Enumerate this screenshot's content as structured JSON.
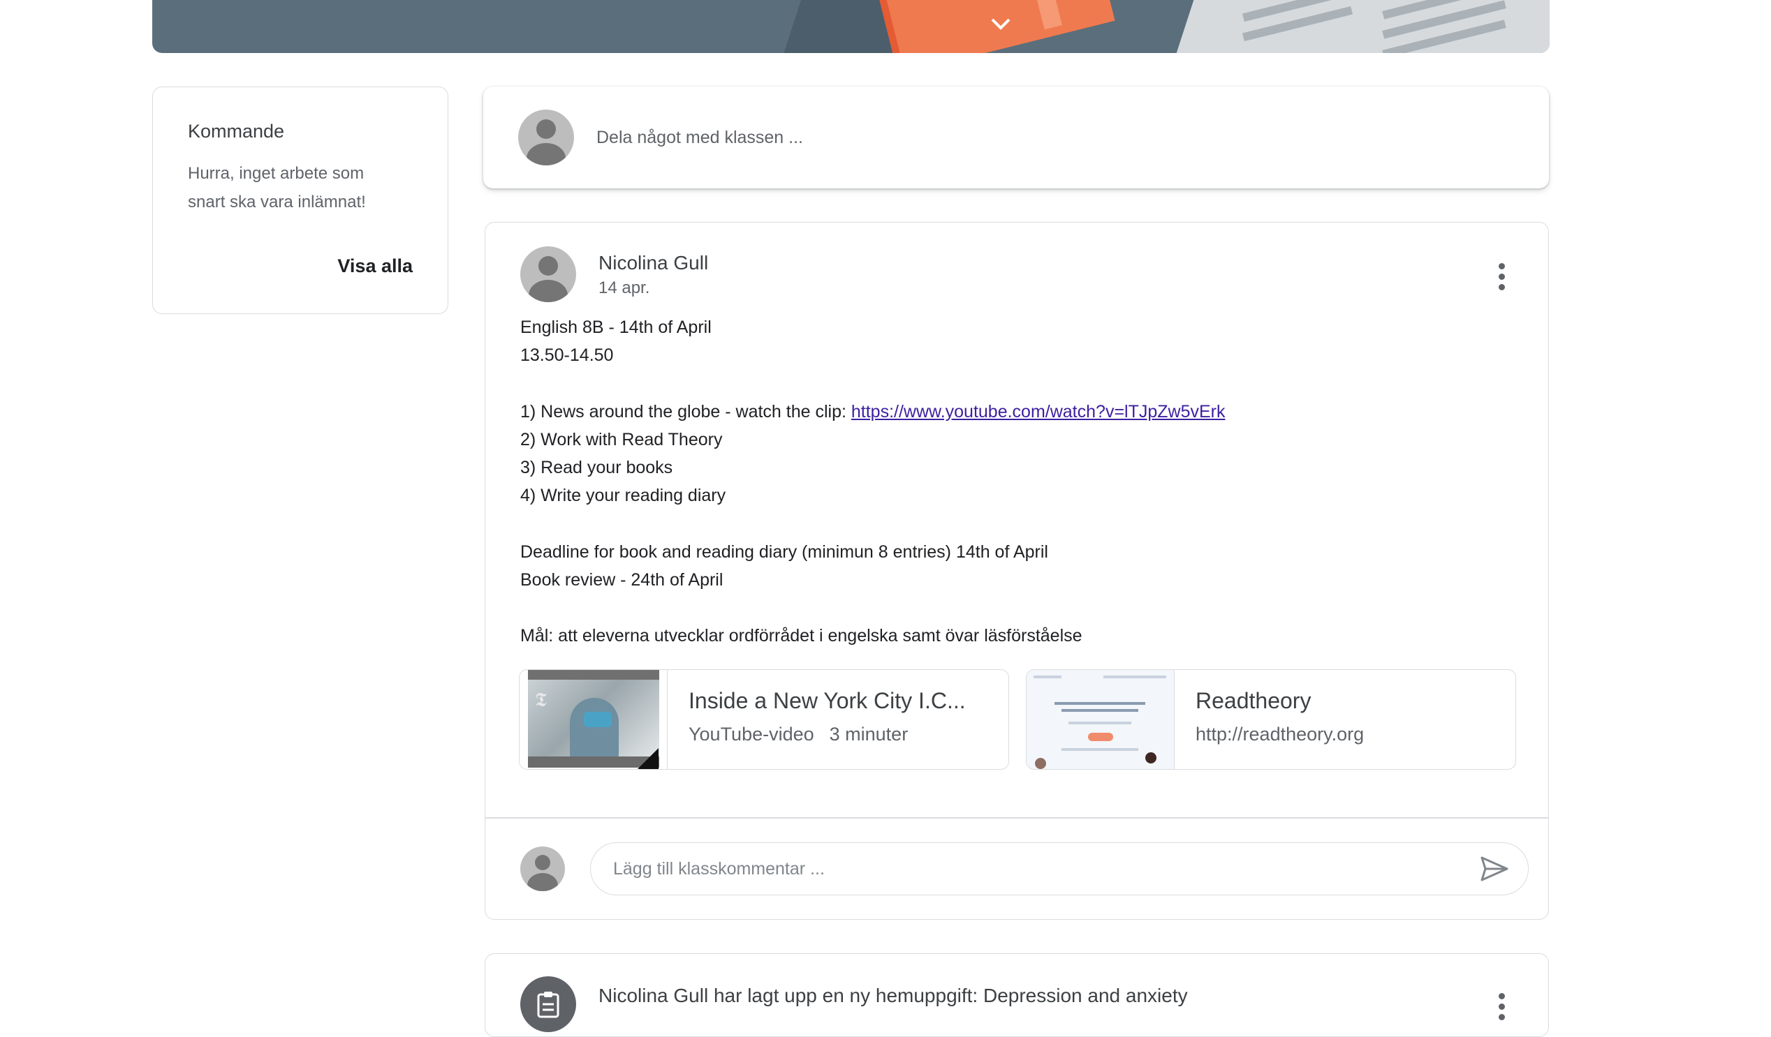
{
  "banner": {
    "expand_icon": "chevron-down-icon"
  },
  "upcoming": {
    "title": "Kommande",
    "message_line1": "Hurra, inget arbete som",
    "message_line2": "snart ska vara inlämnat!",
    "view_all": "Visa alla"
  },
  "share": {
    "placeholder": "Dela något med klassen ..."
  },
  "post": {
    "author": "Nicolina Gull",
    "date": "14 apr.",
    "lines": [
      "English 8B - 14th of April",
      "13.50-14.50",
      "",
      "1) News around the globe - watch the clip: ",
      "2) Work with Read Theory",
      "3) Read your books",
      "4) Write your reading diary",
      "",
      "Deadline for book and reading diary (minimun 8 entries) 14th of April",
      "Book review - 24th of April",
      "",
      "Mål: att eleverna utvecklar ordförrådet i engelska samt övar läsförståelse"
    ],
    "link": "https://www.youtube.com/watch?v=lTJpZw5vErk",
    "attachments": [
      {
        "title": "Inside a New York City I.C...",
        "type": "YouTube-video",
        "duration": "3 minuter"
      },
      {
        "title": "Readtheory",
        "url": "http://readtheory.org"
      }
    ],
    "comment_placeholder": "Lägg till klasskommentar ..."
  },
  "post2": {
    "title": "Nicolina Gull har lagt upp en ny hemuppgift: Depression and anxiety"
  }
}
